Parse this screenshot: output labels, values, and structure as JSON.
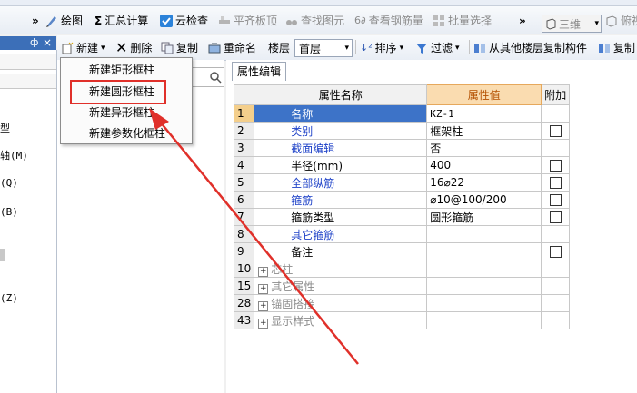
{
  "toolbar1": {
    "chev": "»",
    "draw": "绘图",
    "sum": "汇总计算",
    "cloudcheck": "云检查",
    "flat": "平齐板顶",
    "findelem": "查找图元",
    "viewrebar": "查看钢筋量",
    "batchsel": "批量选择",
    "chev2": "»",
    "view3d": "三维",
    "viewtop": "俯视"
  },
  "left": {
    "pin": "ф",
    "close": "×",
    "items": [
      "型",
      "轴(M)",
      "(Q)",
      "(B)",
      "(Z)"
    ]
  },
  "toolbar2": {
    "new": "新建",
    "del": "删除",
    "copy": "复制",
    "rename": "重命名",
    "floor_label": "楼层",
    "floor_value": "首层",
    "sort": "排序",
    "filter": "过滤",
    "copyfrom": "从其他楼层复制构件",
    "copy2": "复制"
  },
  "menu": {
    "items": [
      "新建矩形框柱",
      "新建圆形框柱",
      "新建异形框柱",
      "新建参数化框柱"
    ]
  },
  "prop": {
    "tab": "属性编辑",
    "headers": {
      "name": "属性名称",
      "value": "属性值",
      "extra": "附加"
    },
    "rows": [
      {
        "n": "1",
        "name": "名称",
        "value": "KZ-1"
      },
      {
        "n": "2",
        "name": "类别",
        "value": "框架柱"
      },
      {
        "n": "3",
        "name": "截面编辑",
        "value": "否"
      },
      {
        "n": "4",
        "name": "半径(mm)",
        "value": "400"
      },
      {
        "n": "5",
        "name": "全部纵筋",
        "value": "16⌀22"
      },
      {
        "n": "6",
        "name": "箍筋",
        "value": "⌀10@100/200"
      },
      {
        "n": "7",
        "name": "箍筋类型",
        "value": "圆形箍筋"
      },
      {
        "n": "8",
        "name": "其它箍筋",
        "value": ""
      },
      {
        "n": "9",
        "name": "备注",
        "value": ""
      },
      {
        "n": "10",
        "name": "芯柱",
        "value": ""
      },
      {
        "n": "15",
        "name": "其它属性",
        "value": ""
      },
      {
        "n": "28",
        "name": "锚固搭接",
        "value": ""
      },
      {
        "n": "43",
        "name": "显示样式",
        "value": ""
      }
    ]
  },
  "colors": {
    "accent": "#3d73c8",
    "highlight_box": "#e0302a",
    "arrow": "#e0302a",
    "value_header": "#fadcb0"
  }
}
